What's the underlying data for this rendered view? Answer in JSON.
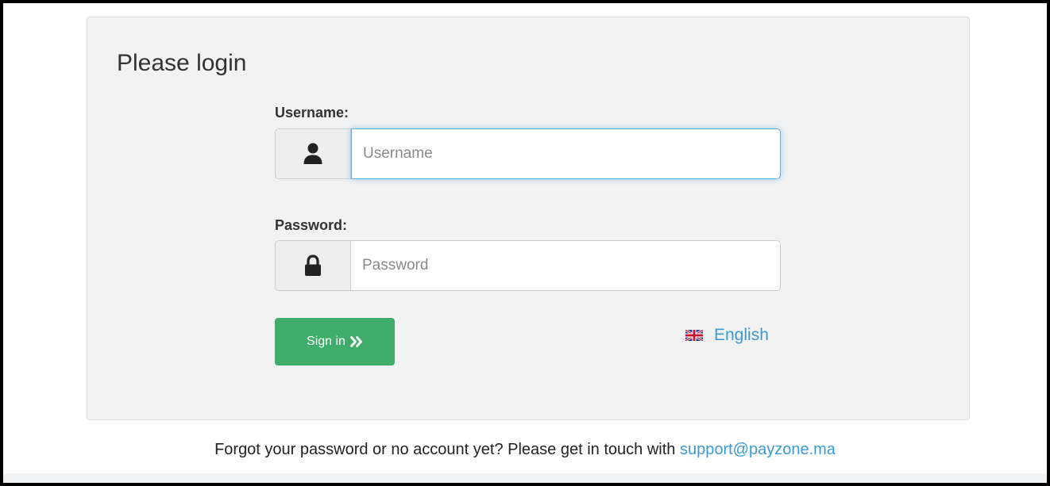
{
  "login": {
    "title": "Please login",
    "username": {
      "label": "Username:",
      "value": "",
      "placeholder": "Username",
      "icon": "user-icon"
    },
    "password": {
      "label": "Password:",
      "value": "",
      "placeholder": "Password",
      "icon": "lock-icon"
    },
    "signin_label": "Sign in",
    "signin_icon": "double-chevron-right-icon",
    "language": {
      "label": "English",
      "icon": "uk-flag-icon"
    }
  },
  "footer": {
    "text": "Forgot your password or no account yet? Please get in touch with",
    "email": "support@payzone.ma"
  },
  "colors": {
    "panel_background": "#f2f2f2",
    "signin_button": "#3fad69",
    "link": "#3a9bd1",
    "focus_border": "#66afe9"
  }
}
